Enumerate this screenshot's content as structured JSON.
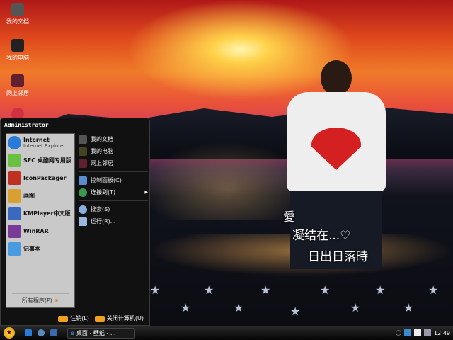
{
  "desktop": {
    "icons": [
      {
        "label": "我的文档"
      },
      {
        "label": "我的电脑"
      },
      {
        "label": "网上邻居"
      },
      {
        "label": ""
      }
    ],
    "wallpaper_text": [
      "愛",
      "凝结在...♡",
      "日出日落時"
    ]
  },
  "start_menu": {
    "user": "Administrator",
    "pinned": [
      {
        "label": "Internet",
        "sub": "Internet Explorer",
        "color": "#2a7ad8"
      },
      {
        "label": "SFC 桌酷网专用版",
        "color": "#6ac040"
      },
      {
        "label": "IconPackager",
        "color": "#c03020"
      },
      {
        "label": "画图",
        "color": "#d8a030"
      },
      {
        "label": "KMPlayer中文版",
        "color": "#3a6ac0"
      },
      {
        "label": "WinRAR",
        "color": "#7a3a9a"
      },
      {
        "label": "记事本",
        "color": "#4a9ae0"
      }
    ],
    "all_programs": "所有程序(P)",
    "places": [
      {
        "label": "我的文档"
      },
      {
        "label": "我的电脑"
      },
      {
        "label": "网上邻居"
      }
    ],
    "system": [
      {
        "label": "控制面板(C)"
      },
      {
        "label": "连接到(T)",
        "submenu": true
      }
    ],
    "tools": [
      {
        "label": "搜索(S)"
      },
      {
        "label": "运行(R)..."
      }
    ],
    "logoff": "注销(L)",
    "shutdown": "关闭计算机(U)"
  },
  "taskbar": {
    "task": "桌面 - 壁纸 - ...",
    "clock": "12:49"
  }
}
